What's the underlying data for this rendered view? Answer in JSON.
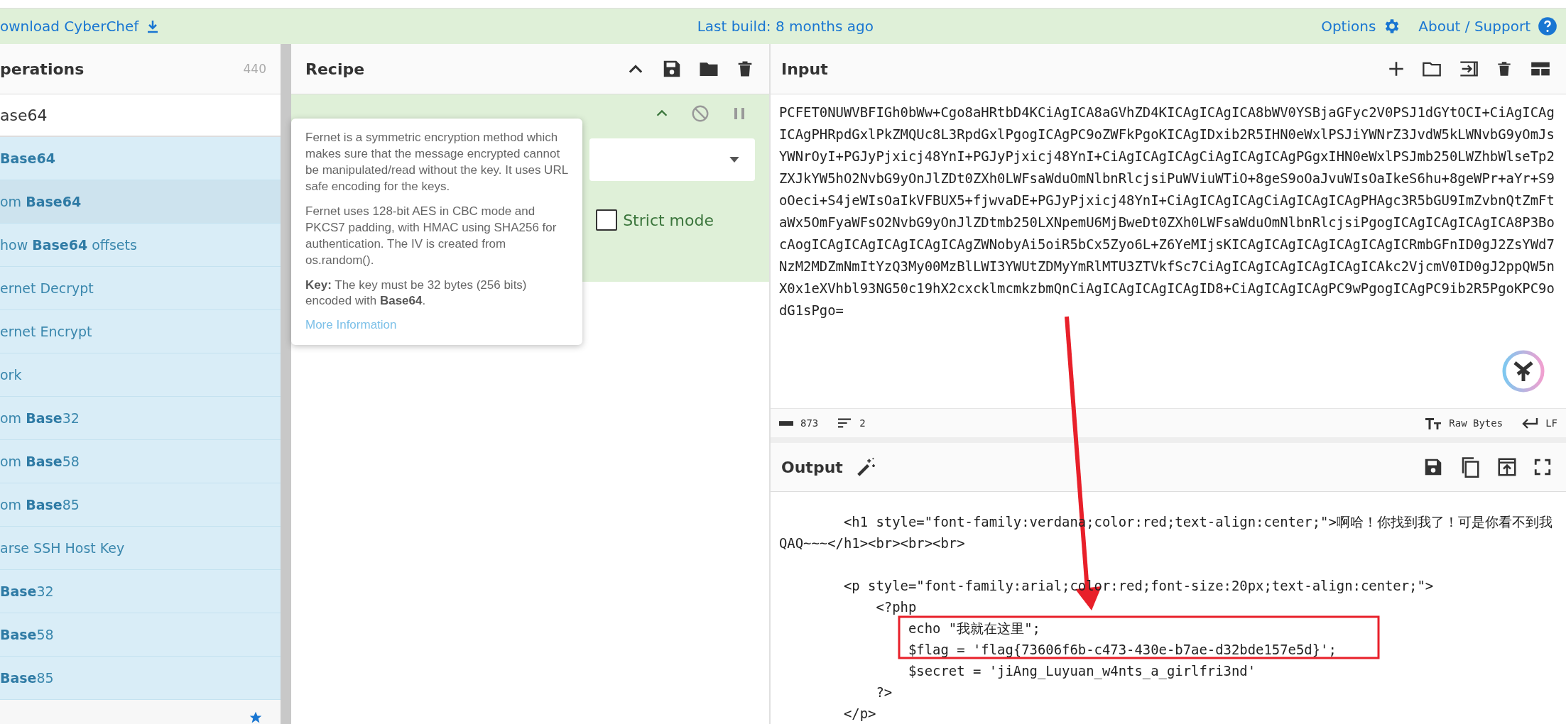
{
  "topbar": {
    "download_label": "ownload CyberChef",
    "build_label": "Last build: 8 months ago",
    "options_label": "Options",
    "about_label": "About / Support"
  },
  "operations": {
    "title": "perations",
    "count": "440",
    "search_value": "ase64",
    "items": [
      {
        "label": "**Base64**",
        "selected": false
      },
      {
        "label": "om **Base64**",
        "selected": true
      },
      {
        "label": "how **Base64** offsets",
        "selected": false
      },
      {
        "label": "ernet Decrypt",
        "selected": false
      },
      {
        "label": "ernet Encrypt",
        "selected": false
      },
      {
        "label": "ork",
        "selected": false
      },
      {
        "label": "om **Base**32",
        "selected": false
      },
      {
        "label": "om **Base**58",
        "selected": false
      },
      {
        "label": "om **Base**85",
        "selected": false
      },
      {
        "label": "arse SSH Host Key",
        "selected": false
      },
      {
        "label": "**Base**32",
        "selected": false
      },
      {
        "label": "**Base**58",
        "selected": false
      },
      {
        "label": "**Base**85",
        "selected": false
      }
    ]
  },
  "recipe": {
    "title": "Recipe",
    "options": [
      {
        "label": "Strict mode",
        "checked": false
      }
    ]
  },
  "popover": {
    "paragraphs": [
      "Fernet is a symmetric encryption method which makes sure that the message encrypted cannot be manipulated/read without the key. It uses URL safe encoding for the keys.",
      "Fernet uses 128-bit AES in CBC mode and PKCS7 padding, with HMAC using SHA256 for authentication. The IV is created from os.random().",
      "**Key:** The key must be 32 bytes (256 bits) encoded with **Base64**."
    ],
    "link": "More Information"
  },
  "input": {
    "title": "Input",
    "text": "PCFET0NUWVBFIGh0bWw+Cgo8aHRtbD4KCiAgICA8aGVhZD4KICAgICAgICA8bWV0YSBjaGFyc2V0PSJ1dGYtOCI+CiAgICAgICAgPHRpdGxlPkZMQUc8L3RpdGxlPgogICAgPC9oZWFkPgoKICAgIDxib2R5IHN0eWxlPSJiYWNrZ3JvdW5kLWNvbG9yOmJsYWNrOyI+PGJyPjxicj48YnI+PGJyPjxicj48YnI+CiAgICAgICAgCiAgICAgICAgPGgxIHN0eWxlPSJmb250LWZhbWlseTp2ZXJkYW5hO2NvbG9yOnJlZDt0ZXh0LWFsaWduOmNlbnRlcjsiPuWViuWTiO+8geS9oOaJvuWIsOaIkeS6hu+8geWPr+aYr+S9oOeci+S4jeWIsOaIkVFBUX5+fjwvaDE+PGJyPjxicj48YnI+CiAgICAgICAgCiAgICAgICAgPHAgc3R5bGU9ImZvbnQtZmFtaWx5OmFyaWFsO2NvbG9yOnJlZDtmb250LXNpemU6MjBweDt0ZXh0LWFsaWduOmNlbnRlcjsiPgogICAgICAgICAgICA8P3BocAogICAgICAgICAgICAgICAgZWNobyAi5oiR5bCx5Zyo6L+Z6YeMIjsKICAgICAgICAgICAgICAgICRmbGFnID0gJ2ZsYWd7NzM2MDZmNmItYzQ3My00MzBlLWI3YWUtZDMyYmRlMTU3ZTVkfSc7CiAgICAgICAgICAgICAgICAkc2VjcmV0ID0gJ2ppQW5nX0x1eXVhbl93NG50c19hX2cxcklmcmkzbmQnCiAgICAgICAgICAgID8+CiAgICAgICAgPC9wPgogICAgPC9ib2R5PgoKPC9odG1sPgo=",
    "status": {
      "chars": "873",
      "lines": "2",
      "encoding": "Raw Bytes",
      "eol": "LF"
    }
  },
  "output": {
    "title": "Output",
    "text": "        <h1 style=\"font-family:verdana;color:red;text-align:center;\">啊哈！你找到我了！可是你看不到我QAQ~~~</h1><br><br><br>\n\n        <p style=\"font-family:arial;color:red;font-size:20px;text-align:center;\">\n            <?php\n                echo \"我就在这里\";\n                $flag = 'flag{73606f6b-c473-430e-b7ae-d32bde157e5d}';\n                $secret = 'jiAng_Luyuan_w4nts_a_girlfri3nd'\n            ?>\n        </p>"
  }
}
